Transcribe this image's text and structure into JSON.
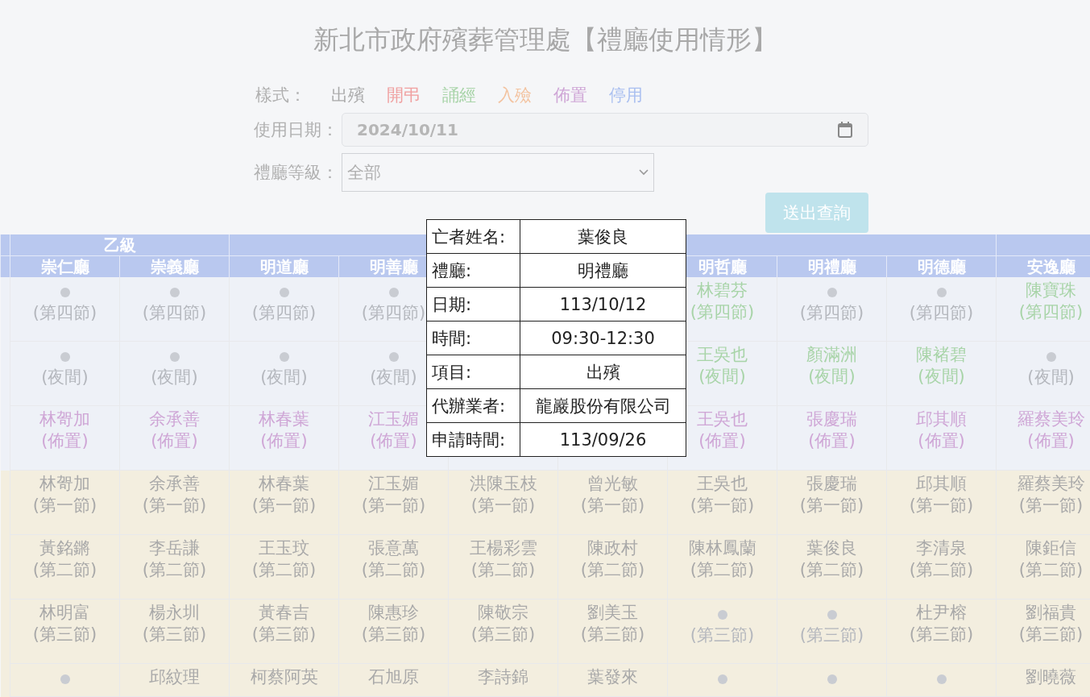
{
  "title": "新北市政府殯葬管理處【禮廳使用情形】",
  "legend": {
    "label": "樣式：",
    "items": [
      {
        "text": "出殯",
        "kind": "funeral"
      },
      {
        "text": "開弔",
        "kind": "memorial"
      },
      {
        "text": "誦經",
        "kind": "chanting"
      },
      {
        "text": "入殮",
        "kind": "encoffin"
      },
      {
        "text": "佈置",
        "kind": "setup"
      },
      {
        "text": "停用",
        "kind": "disabled"
      }
    ]
  },
  "date_field": {
    "label": "使用日期：",
    "value": "2024/10/11"
  },
  "level_field": {
    "label": "禮廳等級：",
    "value": "全部"
  },
  "submit_button": "送出查詢",
  "table": {
    "groups": [
      {
        "label": "乙級",
        "halls": [
          "崇仁廳",
          "崇義廳"
        ]
      },
      {
        "halls": [
          "明道廳",
          "明善廳",
          "明哲廳",
          "明禮廳",
          "明德廳"
        ]
      },
      {
        "halls": [
          "安逸廳"
        ]
      }
    ],
    "rows": [
      {
        "color": "#eef1f7",
        "cells": [
          {
            "kind": "vacant",
            "slot": "(第四節)"
          },
          {
            "kind": "vacant",
            "slot": "(第四節)"
          },
          {
            "kind": "vacant",
            "slot": "(第四節)"
          },
          {
            "kind": "vacant",
            "slot": "(第四節)"
          },
          {},
          {},
          {
            "kind": "chanting",
            "name": "林碧芬",
            "slot": "(第四節)"
          },
          {
            "kind": "vacant",
            "slot": "(第四節)"
          },
          {
            "kind": "vacant",
            "slot": "(第四節)"
          },
          {
            "kind": "chanting",
            "name": "陳寶珠",
            "slot": "(第四節)"
          }
        ]
      },
      {
        "color": "#eef1f7",
        "cells": [
          {
            "kind": "vacant",
            "slot": "(夜間)"
          },
          {
            "kind": "vacant",
            "slot": "(夜間)"
          },
          {
            "kind": "vacant",
            "slot": "(夜間)"
          },
          {
            "kind": "vacant",
            "slot": "(夜間)"
          },
          {},
          {},
          {
            "kind": "chanting",
            "name": "王吳也",
            "slot": "(夜間)"
          },
          {
            "kind": "chanting",
            "name": "顏滿洲",
            "slot": "(夜間)"
          },
          {
            "kind": "chanting",
            "name": "陳褚碧",
            "slot": "(夜間)"
          },
          {
            "kind": "vacant",
            "slot": "(夜間)"
          }
        ]
      },
      {
        "color": "#eef1f7",
        "cells": [
          {
            "kind": "setup",
            "name": "林哿加",
            "slot": "(佈置)"
          },
          {
            "kind": "setup",
            "name": "余承善",
            "slot": "(佈置)"
          },
          {
            "kind": "setup",
            "name": "林春葉",
            "slot": "(佈置)"
          },
          {
            "kind": "setup",
            "name": "江玉媚",
            "slot": "(佈置)"
          },
          {},
          {},
          {
            "kind": "setup",
            "name": "王吳也",
            "slot": "(佈置)"
          },
          {
            "kind": "setup",
            "name": "張慶瑞",
            "slot": "(佈置)"
          },
          {
            "kind": "setup",
            "name": "邱其順",
            "slot": "(佈置)"
          },
          {
            "kind": "setup",
            "name": "羅蔡美玲",
            "slot": "(佈置)"
          }
        ]
      },
      {
        "color": "#f3eedf",
        "cells": [
          {
            "kind": "funeral",
            "name": "林哿加",
            "slot": "(第一節)"
          },
          {
            "kind": "funeral",
            "name": "余承善",
            "slot": "(第一節)"
          },
          {
            "kind": "funeral",
            "name": "林春葉",
            "slot": "(第一節)"
          },
          {
            "kind": "funeral",
            "name": "江玉媚",
            "slot": "(第一節)"
          },
          {
            "kind": "funeral",
            "name": "洪陳玉枝",
            "slot": "(第一節)"
          },
          {
            "kind": "funeral",
            "name": "曾光敏",
            "slot": "(第一節)"
          },
          {
            "kind": "funeral",
            "name": "王吳也",
            "slot": "(第一節)"
          },
          {
            "kind": "funeral",
            "name": "張慶瑞",
            "slot": "(第一節)"
          },
          {
            "kind": "funeral",
            "name": "邱其順",
            "slot": "(第一節)"
          },
          {
            "kind": "funeral",
            "name": "羅蔡美玲",
            "slot": "(第一節)"
          }
        ]
      },
      {
        "color": "#f3eedf",
        "cells": [
          {
            "kind": "funeral",
            "name": "黃銘鏘",
            "slot": "(第二節)"
          },
          {
            "kind": "funeral",
            "name": "李岳謙",
            "slot": "(第二節)"
          },
          {
            "kind": "funeral",
            "name": "王玉玟",
            "slot": "(第二節)"
          },
          {
            "kind": "funeral",
            "name": "張意萬",
            "slot": "(第二節)"
          },
          {
            "kind": "funeral",
            "name": "王楊彩雲",
            "slot": "(第二節)"
          },
          {
            "kind": "funeral",
            "name": "陳政村",
            "slot": "(第二節)"
          },
          {
            "kind": "funeral",
            "name": "陳林鳳蘭",
            "slot": "(第二節)"
          },
          {
            "kind": "funeral",
            "name": "葉俊良",
            "slot": "(第二節)"
          },
          {
            "kind": "funeral",
            "name": "李清泉",
            "slot": "(第二節)"
          },
          {
            "kind": "funeral",
            "name": "陳鉅信",
            "slot": "(第二節)"
          }
        ]
      },
      {
        "color": "#f3eedf",
        "cells": [
          {
            "kind": "funeral",
            "name": "林明富",
            "slot": "(第三節)"
          },
          {
            "kind": "funeral",
            "name": "楊永圳",
            "slot": "(第三節)"
          },
          {
            "kind": "funeral",
            "name": "黃春吉",
            "slot": "(第三節)"
          },
          {
            "kind": "funeral",
            "name": "陳惠珍",
            "slot": "(第三節)"
          },
          {
            "kind": "funeral",
            "name": "陳敬宗",
            "slot": "(第三節)"
          },
          {
            "kind": "funeral",
            "name": "劉美玉",
            "slot": "(第三節)"
          },
          {
            "kind": "vacant",
            "slot": "(第三節)"
          },
          {
            "kind": "vacant",
            "slot": "(第三節)"
          },
          {
            "kind": "funeral",
            "name": "杜尹榕",
            "slot": "(第三節)"
          },
          {
            "kind": "funeral",
            "name": "劉福貴",
            "slot": "(第三節)"
          }
        ]
      },
      {
        "color": "#f3eedf",
        "cells": [
          {
            "kind": "vacant"
          },
          {
            "kind": "funeral",
            "name": "邱紋理"
          },
          {
            "kind": "funeral",
            "name": "柯蔡阿英"
          },
          {
            "kind": "funeral",
            "name": "石旭原"
          },
          {
            "kind": "funeral",
            "name": "李詩錦"
          },
          {
            "kind": "funeral",
            "name": "葉發來"
          },
          {
            "kind": "vacant"
          },
          {
            "kind": "vacant"
          },
          {
            "kind": "vacant"
          },
          {
            "kind": "funeral",
            "name": "劉曉薇"
          }
        ]
      }
    ]
  },
  "popup": [
    {
      "label": "亡者姓名:",
      "value": "葉俊良"
    },
    {
      "label": "禮廳:",
      "value": "明禮廳"
    },
    {
      "label": "日期:",
      "value": "113/10/12"
    },
    {
      "label": "時間:",
      "value": "09:30-12:30"
    },
    {
      "label": "項目:",
      "value": "出殯"
    },
    {
      "label": "代辦業者:",
      "value": "龍巖股份有限公司"
    },
    {
      "label": "申請時間:",
      "value": "113/09/26"
    }
  ]
}
